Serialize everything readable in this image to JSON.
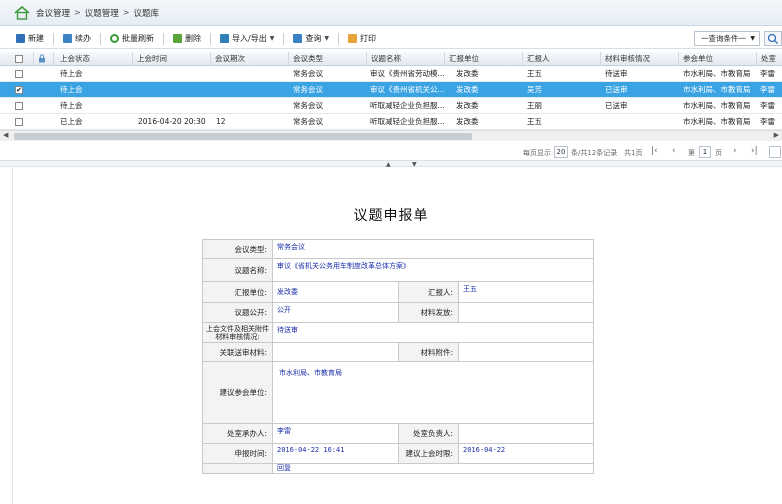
{
  "breadcrumb": {
    "items": [
      "会议管理",
      "议题管理",
      "议题库"
    ],
    "sep": ">"
  },
  "toolbar": {
    "new_label": "新建",
    "continue_label": "续办",
    "batch_refresh_label": "批量刷新",
    "delete_label": "删除",
    "import_export_label": "导入/导出",
    "query_label": "查询",
    "print_label": "打印",
    "query_condition_placeholder": "一查询条件一"
  },
  "grid": {
    "columns": [
      "上会状态",
      "上会时间",
      "会议期次",
      "会议类型",
      "议题名称",
      "汇报单位",
      "汇报人",
      "材料审核情况",
      "参会单位",
      "处室"
    ],
    "rows": [
      {
        "checked": false,
        "selected": false,
        "status": "待上会",
        "time": "",
        "period": "",
        "type": "常务会议",
        "name": "审议《贵州省劳动模...",
        "unit": "发改委",
        "reporter": "王五",
        "review": "待送审",
        "attend": "市水利局、市教育局",
        "office": "李雷"
      },
      {
        "checked": true,
        "selected": true,
        "status": "待上会",
        "time": "",
        "period": "",
        "type": "常务会议",
        "name": "审议《贵州省机关公...",
        "unit": "发改委",
        "reporter": "吴芳",
        "review": "已送审",
        "attend": "市水利局、市教育局",
        "office": "李雷"
      },
      {
        "checked": false,
        "selected": false,
        "status": "待上会",
        "time": "",
        "period": "",
        "type": "常务会议",
        "name": "听取减轻企业负担服...",
        "unit": "发改委",
        "reporter": "王丽",
        "review": "已送审",
        "attend": "市水利局、市教育局",
        "office": "李雷"
      },
      {
        "checked": false,
        "selected": false,
        "status": "已上会",
        "time": "2016-04-20 20:30",
        "period": "12",
        "type": "常务会议",
        "name": "听取减轻企业负担服...",
        "unit": "发改委",
        "reporter": "王五",
        "review": "",
        "attend": "市水利局、市教育局",
        "office": "李雷"
      }
    ]
  },
  "pager": {
    "per_page_label": "每页显示",
    "per_page": "20",
    "summary": "条/共12条记录",
    "total_pages": "共1页",
    "page_prefix": "第",
    "page": "1",
    "page_suffix": "页"
  },
  "form": {
    "title": "议题申报单",
    "meeting_type_label": "会议类型:",
    "meeting_type": "常务会议",
    "topic_name_label": "议题名称:",
    "topic_name": "审议《省机关公务用车制度改革总体方案》",
    "report_unit_label": "汇报单位:",
    "report_unit": "发改委",
    "reporter_label": "汇报人:",
    "reporter": "王五",
    "public_label": "议题公开:",
    "public": "公开",
    "material_issue_label": "材料发放:",
    "material_issue": "",
    "review_label": "上会文件及相关附件材料审核情况:",
    "review": "待送审",
    "related_review_label": "关联送审材料:",
    "related_review": "",
    "attachment_label": "材料附件:",
    "attachment": "",
    "attend_label": "建议参会单位:",
    "attend": "市水利局、市教育局",
    "handler_label": "处室承办人:",
    "handler": "李雷",
    "office_head_label": "处室负责人:",
    "office_head": "",
    "apply_time_label": "申报时间:",
    "apply_time": "2016-04-22 16:41",
    "suggest_time_label": "建议上会时限:",
    "suggest_time": "2016-04-22",
    "last_row_value": "回复"
  }
}
